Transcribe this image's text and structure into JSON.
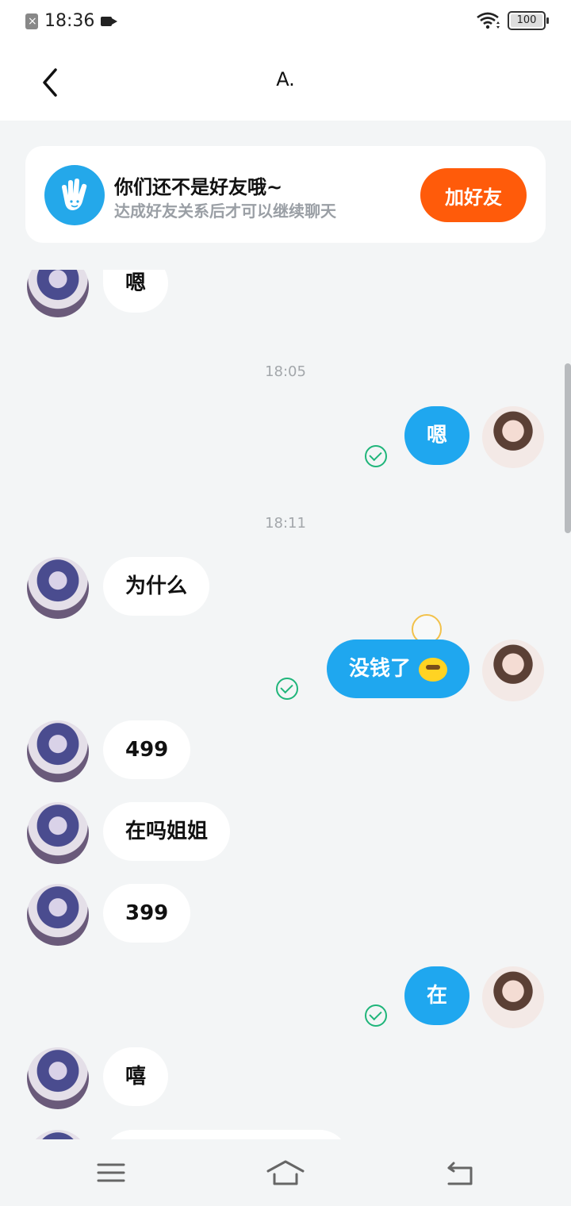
{
  "status_bar": {
    "time": "18:36",
    "battery": "100",
    "icons": [
      "sim-error-icon",
      "video-record-icon",
      "wifi-icon",
      "battery-icon"
    ]
  },
  "header": {
    "title": "A.",
    "back_icon": "chevron-left-icon"
  },
  "friend_banner": {
    "title": "你们还不是好友哦~",
    "subtitle": "达成好友关系后才可以继续聊天",
    "button_label": "加好友",
    "icon": "hand-icon",
    "accent_color": "#ff5b0a",
    "icon_color": "#24a8ea"
  },
  "messages": [
    {
      "side": "in",
      "text": "嗯"
    },
    {
      "type": "time",
      "text": "18:05"
    },
    {
      "side": "out",
      "text": "嗯",
      "read": true
    },
    {
      "type": "time",
      "text": "18:11"
    },
    {
      "side": "in",
      "text": "为什么"
    },
    {
      "side": "out",
      "text": "没钱了",
      "emoji": "chick-emoji",
      "read": true
    },
    {
      "side": "in",
      "text": "499"
    },
    {
      "side": "in",
      "text": "在吗姐姐"
    },
    {
      "side": "in",
      "text": "399"
    },
    {
      "side": "out",
      "text": "在",
      "read": true
    },
    {
      "side": "in",
      "text": "嘻"
    }
  ],
  "colors": {
    "outgoing_bubble": "#1fa7ef",
    "incoming_bubble": "#ffffff",
    "read_check": "#1fb57a",
    "background": "#f3f5f6"
  },
  "nav_bar": {
    "items": [
      "menu-icon",
      "home-icon",
      "back-icon"
    ]
  }
}
